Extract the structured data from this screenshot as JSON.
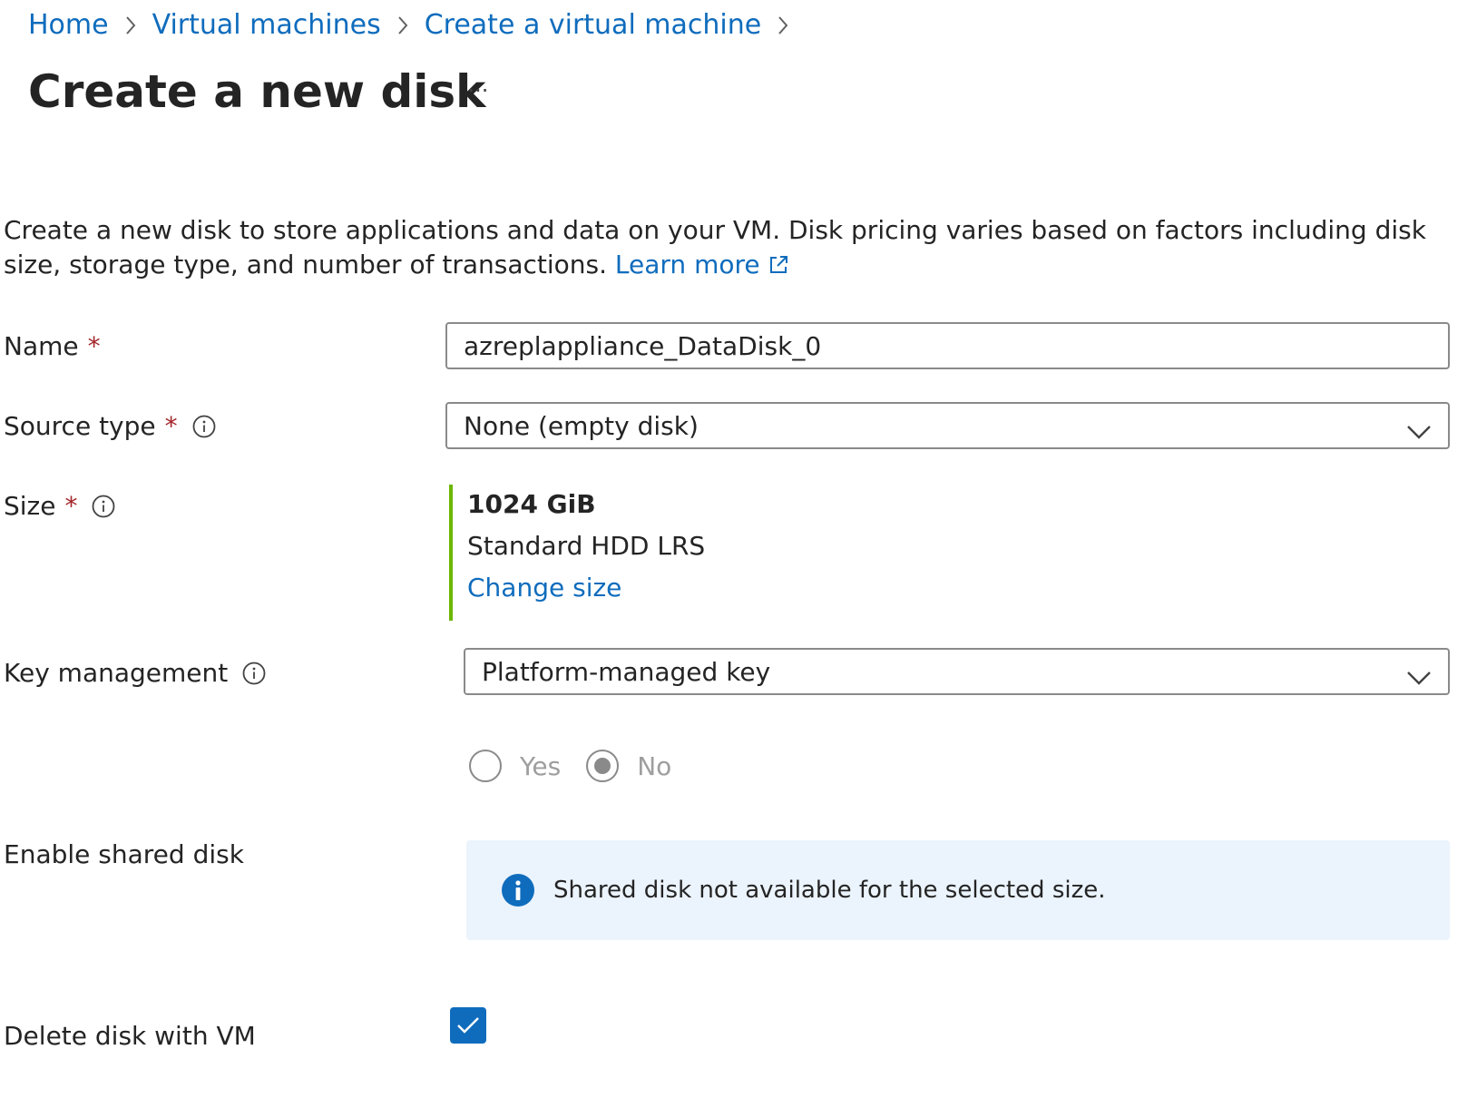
{
  "breadcrumb": {
    "items": [
      {
        "label": "Home"
      },
      {
        "label": "Virtual machines"
      },
      {
        "label": "Create a virtual machine"
      }
    ]
  },
  "header": {
    "title": "Create a new disk",
    "more_label": "···"
  },
  "description": {
    "text": "Create a new disk to store applications and data on your VM. Disk pricing varies based on factors including disk size, storage type, and number of transactions.",
    "learn_more": "Learn more"
  },
  "form": {
    "required_marker": "*",
    "name": {
      "label": "Name",
      "value": "azreplappliance_DataDisk_0"
    },
    "source_type": {
      "label": "Source type",
      "value": "None (empty disk)"
    },
    "size": {
      "label": "Size",
      "value": "1024 GiB",
      "tier": "Standard HDD LRS",
      "change_label": "Change size"
    },
    "key_management": {
      "label": "Key management",
      "value": "Platform-managed key"
    },
    "radio": {
      "yes_label": "Yes",
      "no_label": "No",
      "selected": "No"
    },
    "shared_disk": {
      "label": "Enable shared disk",
      "message": "Shared disk not available for the selected size."
    },
    "delete_with_vm": {
      "label": "Delete disk with VM",
      "checked": true
    }
  },
  "colors": {
    "link": "#0f6cbd",
    "required": "#a4262c",
    "size_accent": "#6bb700",
    "banner_bg": "#ebf3fc",
    "checkbox": "#0f6cbd"
  }
}
